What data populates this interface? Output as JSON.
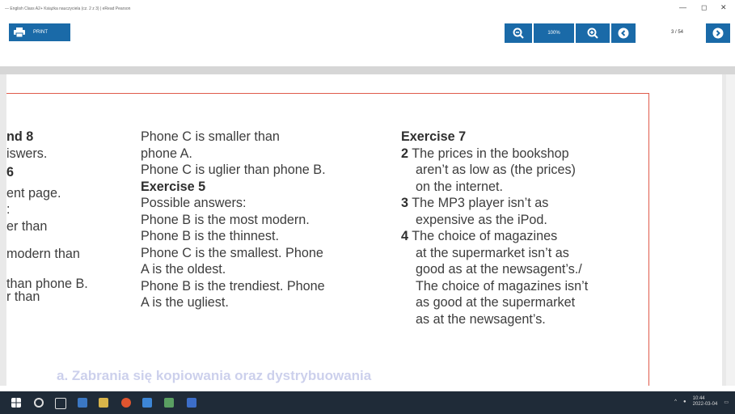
{
  "window": {
    "title": "— English Class A2+ Książka nauczyciela (cz. 2 z 3) | eRead Pearson",
    "minimize": "—",
    "maximize": "◻",
    "close": "✕"
  },
  "toolbar": {
    "print_label": "PRINT",
    "zoom_level": "100%",
    "page_indicator": "3 / 54"
  },
  "icons": {
    "print": "printer-icon",
    "zoom_out": "zoom-out-icon",
    "zoom_in": "zoom-in-icon",
    "prev": "chevron-left-icon",
    "next": "chevron-right-icon"
  },
  "colors": {
    "accent": "#1a6aa8",
    "frame": "#e05b4a",
    "taskbar": "#1f2b38"
  },
  "document": {
    "col1": [
      "nd 8",
      "iswers.",
      "6",
      "ent page.",
      "",
      ":",
      "er than",
      "",
      "modern than",
      "",
      "than phone B.",
      "r than"
    ],
    "col2": [
      "Phone C is smaller than",
      "phone A.",
      "Phone C is uglier than phone B.",
      "Exercise 5",
      "Possible answers:",
      "Phone B is the most modern.",
      "Phone B is the thinnest.",
      "Phone C is the smallest. Phone",
      "A is the oldest.",
      "Phone B is the trendiest. Phone",
      "A is the ugliest."
    ],
    "col3": [
      "Exercise 7",
      {
        "num": "2",
        "text": "The prices in the bookshop"
      },
      "aren’t as low as (the prices)",
      "on the internet.",
      {
        "num": "3",
        "text": "The MP3 player isn’t as"
      },
      "expensive as the iPod.",
      {
        "num": "4",
        "text": "The choice of magazines"
      },
      "at the supermarket isn’t as",
      "good as at the newsagent’s./",
      "The choice of magazines isn’t",
      "as good at the supermarket",
      "as at the newsagent’s."
    ],
    "watermark": "a. Zabrania się kopiowania oraz dystrybuowania"
  },
  "taskbar": {
    "time": "10:44",
    "date": "2022-03-04"
  }
}
